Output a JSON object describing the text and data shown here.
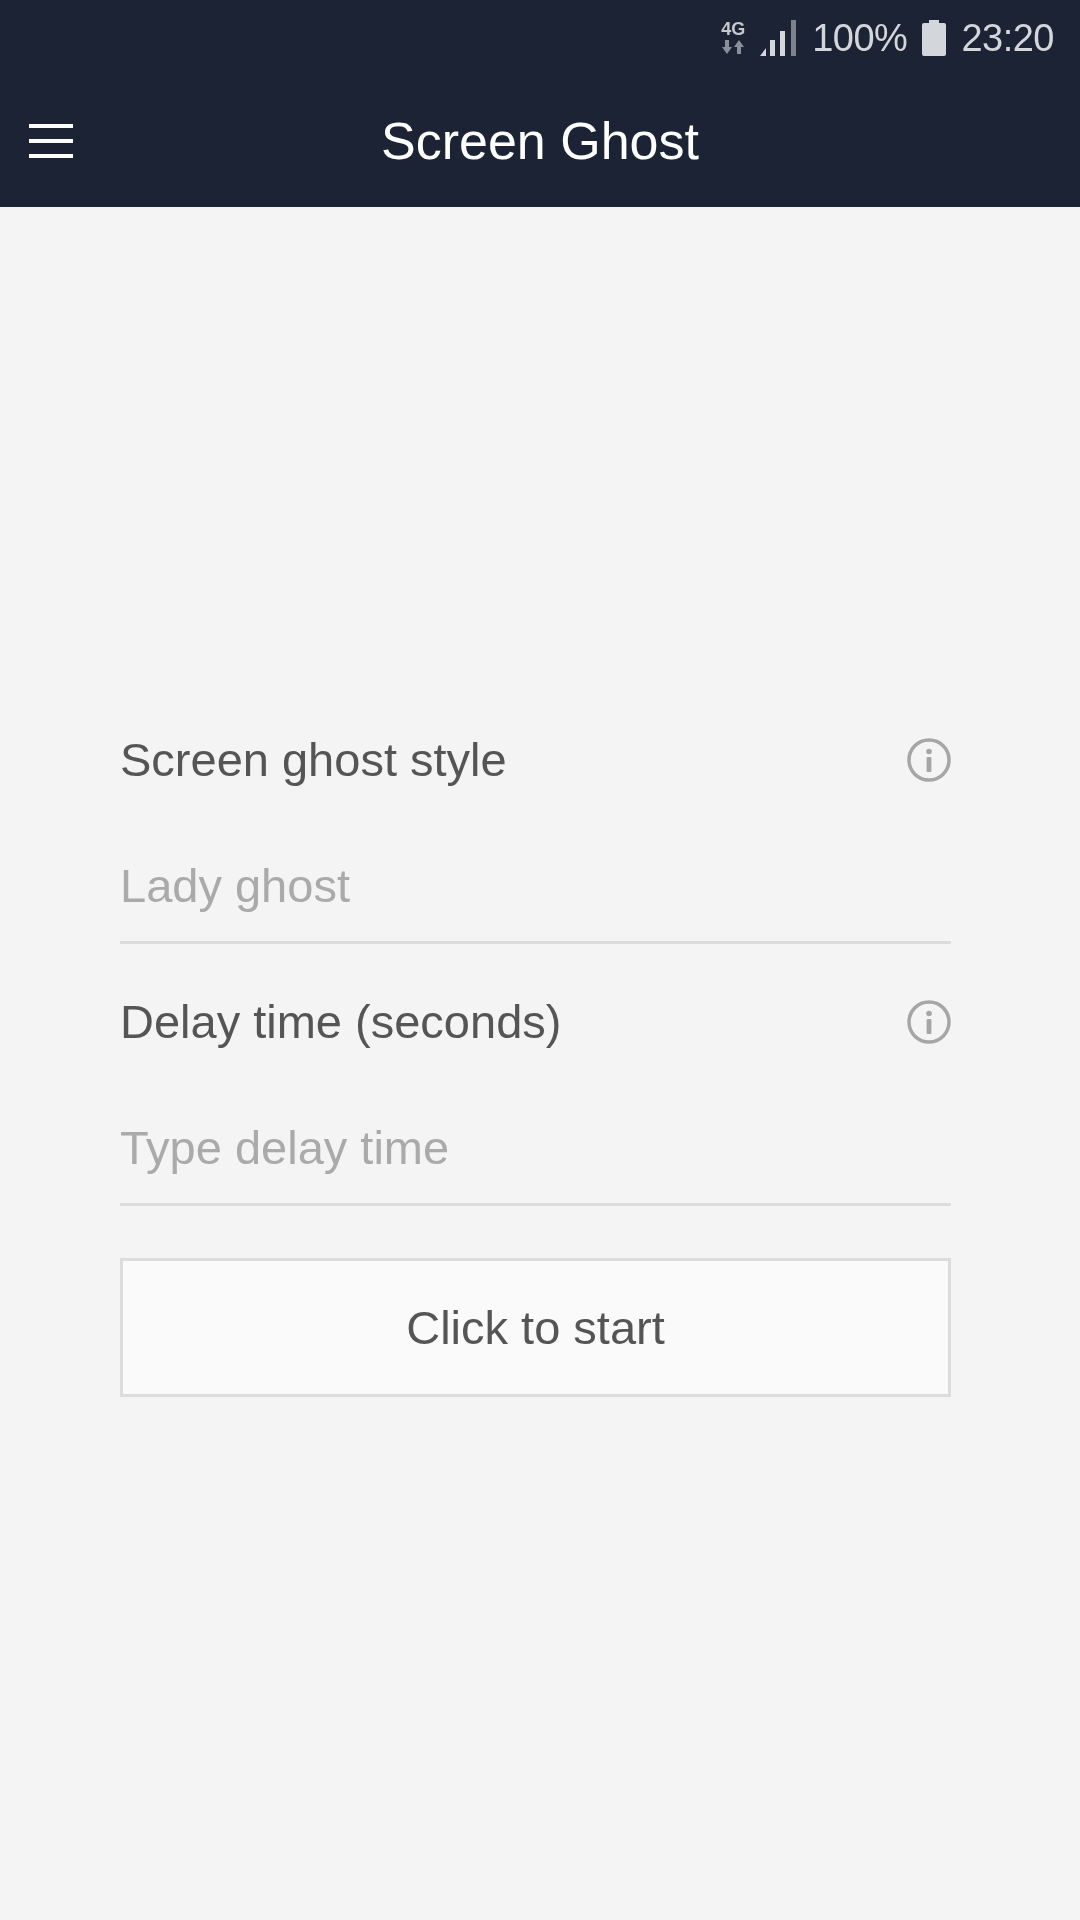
{
  "status_bar": {
    "network": "4G",
    "battery": "100%",
    "time": "23:20"
  },
  "app_bar": {
    "title": "Screen Ghost"
  },
  "form": {
    "fields": [
      {
        "label": "Screen ghost style",
        "placeholder": "Lady ghost"
      },
      {
        "label": "Delay time (seconds)",
        "placeholder": "Type delay time"
      }
    ],
    "start_button": "Click to start"
  }
}
